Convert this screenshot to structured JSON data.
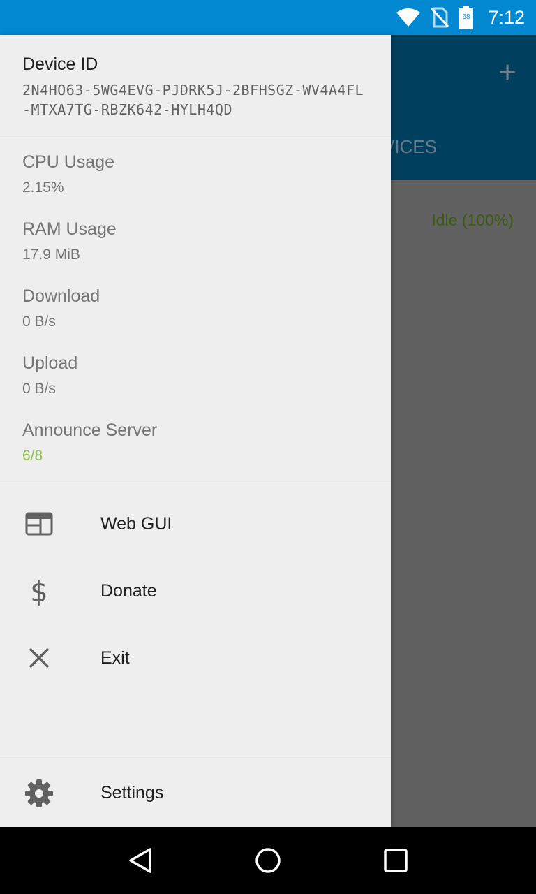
{
  "status_bar": {
    "time": "7:12",
    "battery_level": "68",
    "icons": [
      "wifi-icon",
      "no-sim-icon",
      "battery-icon"
    ]
  },
  "background_app": {
    "add_label": "+",
    "tab_label": "VICES",
    "device_status": "Idle (100%)"
  },
  "drawer": {
    "device": {
      "title": "Device ID",
      "id": "2N4HO63-5WG4EVG-PJDRK5J-2BFHSGZ-WV4A4FL-MTXA7TG-RBZK642-HYLH4QD"
    },
    "stats": [
      {
        "label": "CPU Usage",
        "value": "2.15%"
      },
      {
        "label": "RAM Usage",
        "value": "17.9 MiB"
      },
      {
        "label": "Download",
        "value": "0 B/s"
      },
      {
        "label": "Upload",
        "value": "0 B/s"
      },
      {
        "label": "Announce Server",
        "value": "6/8"
      }
    ],
    "menu": [
      {
        "label": "Web GUI",
        "icon": "web-icon"
      },
      {
        "label": "Donate",
        "icon": "dollar-icon"
      },
      {
        "label": "Exit",
        "icon": "close-icon"
      }
    ],
    "settings": {
      "label": "Settings",
      "icon": "gear-icon"
    }
  },
  "colors": {
    "status_bar": "#0288d1",
    "toolbar": "#013f5e",
    "drawer_bg": "#eeeeee",
    "announce_ok": "#8bc34a"
  },
  "nav_bar": [
    "back-icon",
    "home-icon",
    "recents-icon"
  ]
}
